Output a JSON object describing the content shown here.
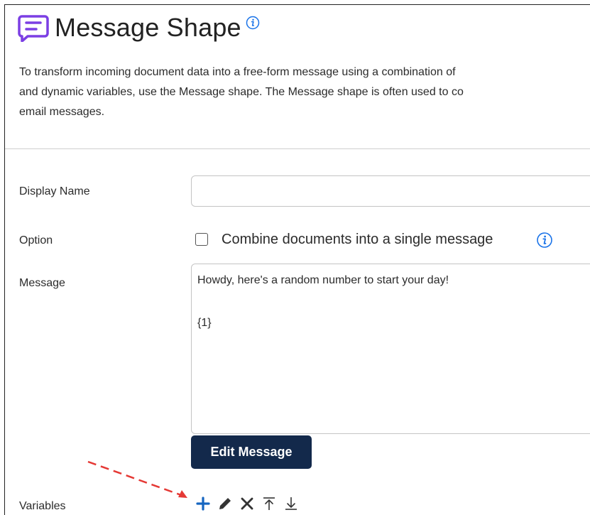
{
  "header": {
    "title": "Message Shape",
    "description_lines": [
      "To transform incoming document data into a free-form message using a combination of",
      "and dynamic variables, use the Message shape. The Message shape is often used to co",
      "email messages."
    ]
  },
  "form": {
    "display_name": {
      "label": "Display Name",
      "value": ""
    },
    "option": {
      "label": "Option",
      "checkbox_label": "Combine documents into a single message",
      "checked": false
    },
    "message": {
      "label": "Message",
      "lines": [
        "Howdy, here's a random number to start your day!",
        "{1}"
      ]
    },
    "edit_button_label": "Edit Message",
    "variables": {
      "label": "Variables",
      "toolbar_icons": [
        "add-icon",
        "pencil-icon",
        "delete-icon",
        "move-top-icon",
        "move-bottom-icon"
      ]
    }
  },
  "colors": {
    "brand_purple": "#7b3fe4",
    "info_blue": "#1a73e8",
    "button_navy": "#13294b",
    "add_blue": "#1565c0",
    "arrow_red": "#e53935"
  }
}
